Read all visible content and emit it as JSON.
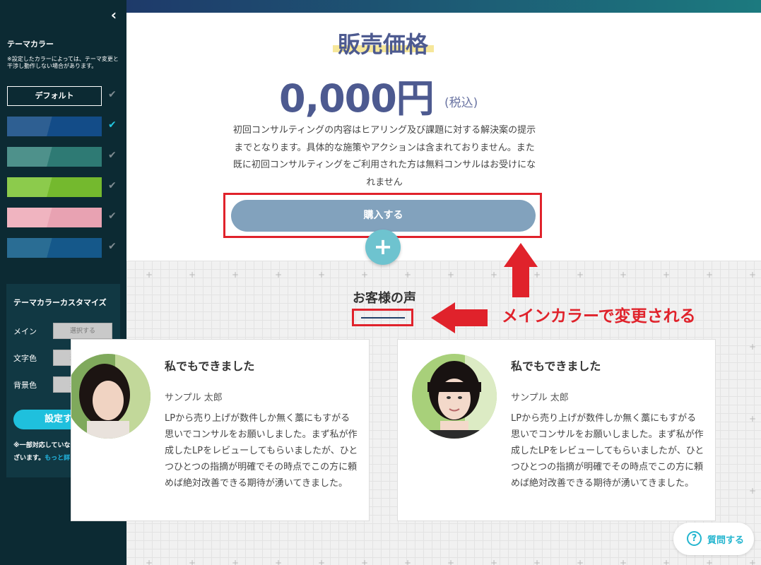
{
  "colors": {
    "sidebar_bg": "#0c2a33",
    "accent": "#1fc0dd",
    "heading": "#4d5a90",
    "annotation_red": "#e0222b",
    "buy_button": "#82a2bd"
  },
  "sidebar": {
    "collapse_icon": "chevron-left-icon",
    "theme_title": "テーマカラー",
    "theme_note": "※設定したカラーによっては、テーマ変更と干渉し動作しない場合があります。",
    "default_label": "デフォルト",
    "swatches": [
      {
        "colors": [
          "#2e5f92",
          "#134c88"
        ],
        "selected": true
      },
      {
        "colors": [
          "#4e918b",
          "#2e7a74"
        ],
        "selected": false
      },
      {
        "colors": [
          "#8ccb4c",
          "#74b92e"
        ],
        "selected": false
      },
      {
        "colors": [
          "#f0b4c0",
          "#e8a2b2"
        ],
        "selected": false
      },
      {
        "colors": [
          "#2a6d94",
          "#15588a"
        ],
        "selected": false
      }
    ],
    "custom": {
      "title": "テーマカラーカスタマイズ",
      "main_label": "メイン",
      "text_color_label": "文字色",
      "bg_color_label": "背景色",
      "select_label": "選択する",
      "submit_label": "設定する",
      "note": "※一部対応していないブロックがございます。",
      "more_link": "もっと詳しく"
    }
  },
  "main": {
    "price_heading": "販売価格",
    "price_amount": "0,000円",
    "price_tax": "(税込)",
    "description": "初回コンサルティングの内容はヒアリング及び課題に対する解決案の提示までとなります。具体的な施策やアクションは含まれておりません。また既に初回コンサルティングをご利用された方は無料コンサルはお受けになれません",
    "buy_button": "購入する",
    "add_button": "+",
    "voice_title": "お客様の声",
    "annotation": "メインカラーで変更される"
  },
  "testimonials": [
    {
      "title": "私でもできました",
      "name": "サンプル 太郎",
      "text": "LPから売り上げが数件しか無く藁にもすがる思いでコンサルをお願いしました。まず私が作成したLPをレビューしてもらいましたが、ひとつひとつの指摘が明確でその時点でこの方に頼めば絶対改善できる期待が湧いてきました。"
    },
    {
      "title": "私でもできました",
      "name": "サンプル 太郎",
      "text": "LPから売り上げが数件しか無く藁にもすがる思いでコンサルをお願いしました。まず私が作成したLPをレビューしてもらいましたが、ひとつひとつの指摘が明確でその時点でこの方に頼めば絶対改善できる期待が湧いてきました。"
    }
  ],
  "help": {
    "icon": "question-circle-icon",
    "label": "質問する"
  }
}
